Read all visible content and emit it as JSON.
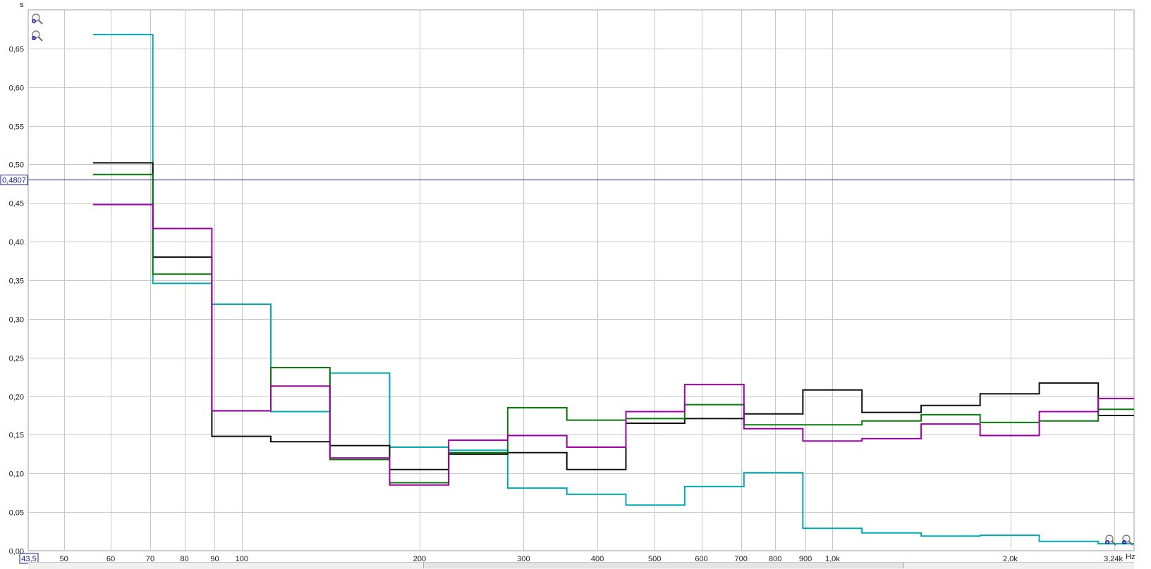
{
  "chart_data": {
    "type": "line",
    "step": true,
    "x_scale": "log",
    "ylabel": "s",
    "x_unit": "Hz",
    "xlim": [
      43.5,
      3240
    ],
    "ylim": [
      0,
      0.7
    ],
    "grid": true,
    "y_ticks": [
      {
        "value": 0.0,
        "label": "0,00"
      },
      {
        "value": 0.05,
        "label": "0,05"
      },
      {
        "value": 0.1,
        "label": "0,10"
      },
      {
        "value": 0.15,
        "label": "0,15"
      },
      {
        "value": 0.2,
        "label": "0,20"
      },
      {
        "value": 0.25,
        "label": "0,25"
      },
      {
        "value": 0.3,
        "label": "0,30"
      },
      {
        "value": 0.35,
        "label": "0,35"
      },
      {
        "value": 0.4,
        "label": "0,40"
      },
      {
        "value": 0.45,
        "label": "0,45"
      },
      {
        "value": 0.5,
        "label": "0,50"
      },
      {
        "value": 0.55,
        "label": "0,55"
      },
      {
        "value": 0.6,
        "label": "0,60"
      },
      {
        "value": 0.65,
        "label": "0,65"
      }
    ],
    "x_ticks": [
      {
        "value": 50,
        "label": "50"
      },
      {
        "value": 60,
        "label": "60"
      },
      {
        "value": 70,
        "label": "70"
      },
      {
        "value": 80,
        "label": "80"
      },
      {
        "value": 90,
        "label": "90"
      },
      {
        "value": 100,
        "label": "100"
      },
      {
        "value": 200,
        "label": "200"
      },
      {
        "value": 300,
        "label": "300"
      },
      {
        "value": 400,
        "label": "400"
      },
      {
        "value": 500,
        "label": "500"
      },
      {
        "value": 600,
        "label": "600"
      },
      {
        "value": 700,
        "label": "700"
      },
      {
        "value": 800,
        "label": "800"
      },
      {
        "value": 900,
        "label": "900"
      },
      {
        "value": 1000,
        "label": "1,0k"
      },
      {
        "value": 2000,
        "label": "2,0k"
      },
      {
        "value": 3240,
        "label": "3,24k"
      }
    ],
    "x_start_label": "43,5",
    "reference_line": {
      "value": 0.4807,
      "label": "0,4807",
      "color": "#1a1aa6"
    },
    "band_edges": [
      56,
      70.7,
      89,
      112,
      141,
      178,
      224,
      282,
      355,
      447,
      562,
      708,
      891,
      1122,
      1413,
      1778,
      2239,
      2818,
      3240
    ],
    "series": [
      {
        "color": "#00aab0",
        "values": [
          0.668,
          0.346,
          0.319,
          0.18,
          0.23,
          0.134,
          0.13,
          0.081,
          0.073,
          0.059,
          0.083,
          0.101,
          0.029,
          0.023,
          0.019,
          0.02,
          0.012,
          0.009
        ]
      },
      {
        "color": "#101010",
        "values": [
          0.502,
          0.38,
          0.148,
          0.141,
          0.136,
          0.105,
          0.125,
          0.127,
          0.105,
          0.165,
          0.171,
          0.177,
          0.208,
          0.179,
          0.188,
          0.203,
          0.217,
          0.175
        ]
      },
      {
        "color": "#0a7a0a",
        "values": [
          0.487,
          0.358,
          0.181,
          0.237,
          0.118,
          0.088,
          0.127,
          0.185,
          0.169,
          0.171,
          0.189,
          0.163,
          0.163,
          0.168,
          0.176,
          0.166,
          0.168,
          0.183
        ]
      },
      {
        "color": "#a000a8",
        "values": [
          0.448,
          0.417,
          0.181,
          0.213,
          0.12,
          0.085,
          0.143,
          0.149,
          0.134,
          0.18,
          0.215,
          0.158,
          0.142,
          0.145,
          0.164,
          0.149,
          0.18,
          0.197
        ]
      }
    ]
  },
  "icons": {
    "zoom_in": "magnifier-plus-icon",
    "zoom_out": "magnifier-minus-icon"
  }
}
